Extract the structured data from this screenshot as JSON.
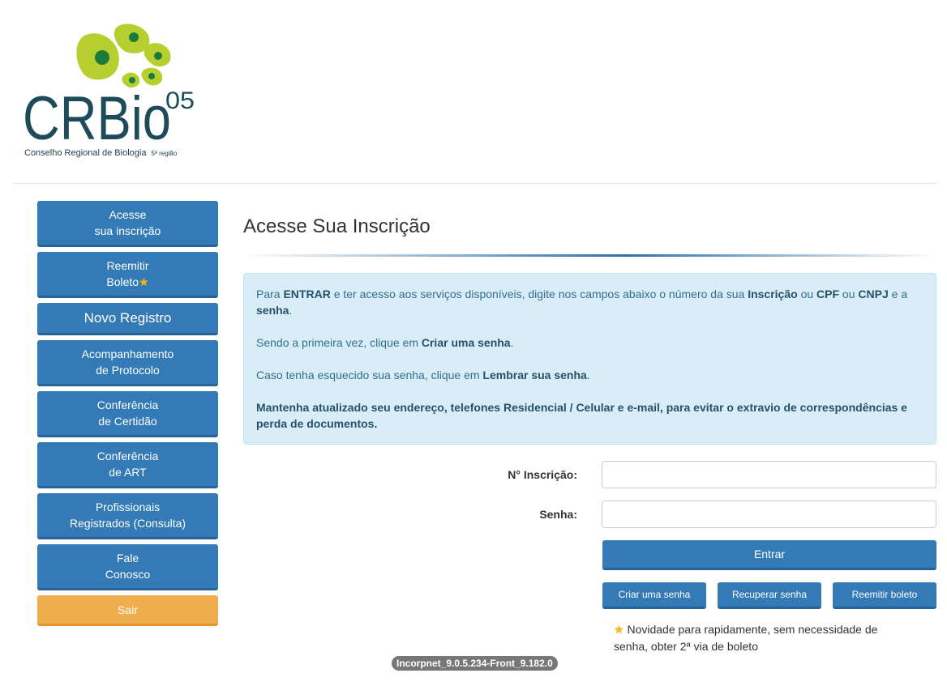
{
  "logo": {
    "main_text": "CRBio",
    "superscript": "05",
    "subtitle": "Conselho Regional de Biologia",
    "region": "5ª região",
    "colors": {
      "lime": "#b7cf2e",
      "green": "#1e7a3c",
      "teal": "#1d4b5a"
    }
  },
  "sidebar": {
    "items": [
      {
        "line1": "Acesse",
        "line2": "sua inscrição"
      },
      {
        "line1": "Reemitir",
        "line2": "Boleto",
        "icon": "star-icon"
      },
      {
        "line1": "Novo Registro"
      },
      {
        "line1": "Acompanhamento",
        "line2": "de Protocolo"
      },
      {
        "line1": "Conferência",
        "line2": "de Certidão"
      },
      {
        "line1": "Conferência",
        "line2": "de ART"
      },
      {
        "line1": "Profissionais",
        "line2": "Registrados (Consulta)"
      },
      {
        "line1": "Fale",
        "line2": "Conosco"
      },
      {
        "line1": "Sair"
      }
    ]
  },
  "main": {
    "title": "Acesse Sua Inscrição",
    "info": {
      "p1": {
        "t1": "Para ",
        "b1": "ENTRAR",
        "t2": " e ter acesso aos serviços disponíveis, digite nos campos abaixo o número da sua ",
        "b2": "Inscrição",
        "t3": " ou ",
        "b3": "CPF",
        "t4": " ou ",
        "b4": "CNPJ",
        "t5": " e a ",
        "b5": "senha",
        "t6": "."
      },
      "p2": {
        "t1": "Sendo a primeira vez, clique em ",
        "b1": "Criar uma senha",
        "t2": "."
      },
      "p3": {
        "t1": "Caso tenha esquecido sua senha, clique em ",
        "b1": "Lembrar sua senha",
        "t2": "."
      },
      "p4": "Mantenha atualizado seu endereço, telefones Residencial / Celular e e-mail, para evitar o extravio de correspondências e perda de documentos."
    },
    "form": {
      "inscricao_label": "N° Inscrição:",
      "inscricao_value": "",
      "senha_label": "Senha:",
      "senha_value": "",
      "submit_label": "Entrar",
      "create_label": "Criar uma senha",
      "recover_label": "Recuperar senha",
      "reissue_label": "Reemitir boleto"
    },
    "note": "Novidade para rapidamente, sem necessidade de senha, obter 2ª via de boleto"
  },
  "footer": {
    "version": "Incorpnet_9.0.5.234-Front_9.182.0"
  },
  "colors": {
    "primary": "#337ab7",
    "warning": "#f0ad4e",
    "info_bg": "#d9edf7",
    "info_text": "#31708f"
  }
}
